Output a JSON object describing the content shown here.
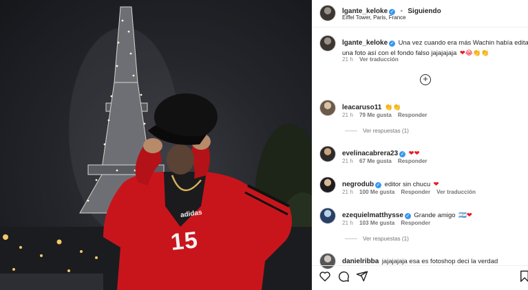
{
  "post": {
    "username": "lgante_keloke",
    "follow_status": "Siguiendo",
    "location": "Eiffel Tower, Paris, France",
    "caption": "Una vez cuando era más Wachin había editado una foto así con el fondo falso jajajajaja",
    "caption_line1": "Una vez cuando era más Wachin había editado",
    "caption_line2": "una foto así con el fondo falso jajajajaja",
    "caption_emojis": "❤😂👏👏",
    "caption_time": "21 h",
    "see_translation": "Ver traducción",
    "jersey_brand": "adidas",
    "jersey_number": "15"
  },
  "comments": [
    {
      "username": "leacaruso11",
      "verified": false,
      "text": "👏👏",
      "time": "21 h",
      "likes": "79 Me gusta",
      "reply": "Responder",
      "view_replies": "Ver respuestas (1)"
    },
    {
      "username": "evelinacabrera23",
      "verified": true,
      "text": "❤❤",
      "time": "21 h",
      "likes": "67 Me gusta",
      "reply": "Responder"
    },
    {
      "username": "negrodub",
      "verified": true,
      "text": "editor sin chucu",
      "emoji": "❤",
      "time": "21 h",
      "likes": "100 Me gusta",
      "reply": "Responder",
      "translate": "Ver traducción"
    },
    {
      "username": "ezequielmatthysse",
      "verified": true,
      "text": "Grande amigo",
      "emoji": "🇦🇷❤",
      "time": "21 h",
      "likes": "103 Me gusta",
      "reply": "Responder",
      "view_replies": "Ver respuestas (1)"
    },
    {
      "username": "danielribba",
      "verified": false,
      "text": "jajajajaja esa es fotoshop deci la verdad"
    }
  ],
  "icons": [
    "verified-badge",
    "add-comment-icon",
    "heart-icon",
    "comment-icon",
    "share-icon",
    "save-icon"
  ],
  "colors": {
    "verified": "#3897f0",
    "heart": "#ed1b24",
    "secondary_text": "#8e8e8e"
  }
}
